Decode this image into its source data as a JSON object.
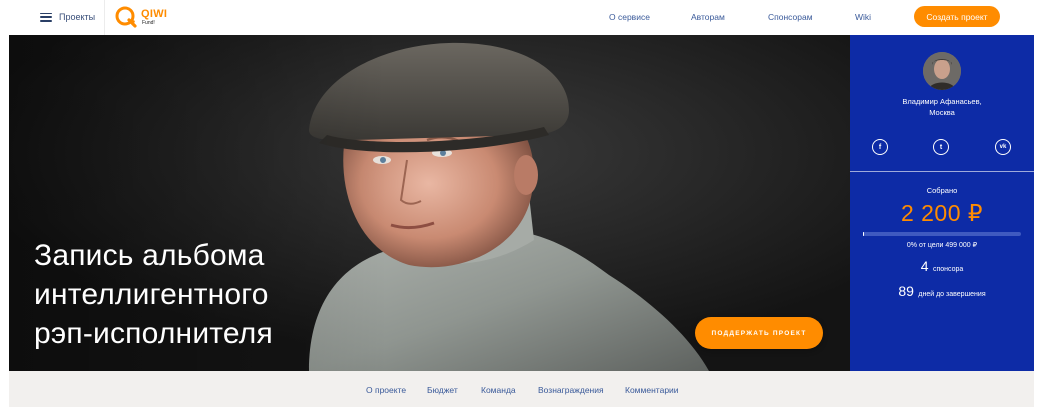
{
  "header": {
    "menu_label": "Проекты",
    "logo": {
      "brand": "QIWI",
      "sub": "Fund!"
    },
    "nav": [
      "О сервисе",
      "Авторам",
      "Спонсорам",
      "Wiki"
    ],
    "create_label": "Создать проект"
  },
  "hero": {
    "title_lines": [
      "Запись альбома",
      "интеллигентного",
      "рэп-исполнителя"
    ],
    "support_label": "ПОДДЕРЖАТЬ ПРОЕКТ"
  },
  "sidebar": {
    "author_name": "Владимир Афанасьев,",
    "author_city": "Москва",
    "social": [
      {
        "icon": "facebook-icon",
        "glyph": "f"
      },
      {
        "icon": "twitter-icon",
        "glyph": "t"
      },
      {
        "icon": "vk-icon",
        "glyph": "vk"
      }
    ],
    "raised_label": "Собрано",
    "raised_amount": "2 200 ₽",
    "progress_fraction": 0.0044,
    "goal_text": "0% от цели 499 000 ₽",
    "sponsors_count": "4",
    "sponsors_label": "спонсора",
    "days_count": "89",
    "days_label": "дней до завершения"
  },
  "tabs": [
    "О проекте",
    "Бюджет",
    "Команда",
    "Вознаграждения",
    "Комментарии"
  ],
  "colors": {
    "accent": "#ff8c00",
    "sidebar_bg": "#0d2ba6",
    "link": "#3a5a9a",
    "tabs_bg": "#f2f0ee"
  }
}
